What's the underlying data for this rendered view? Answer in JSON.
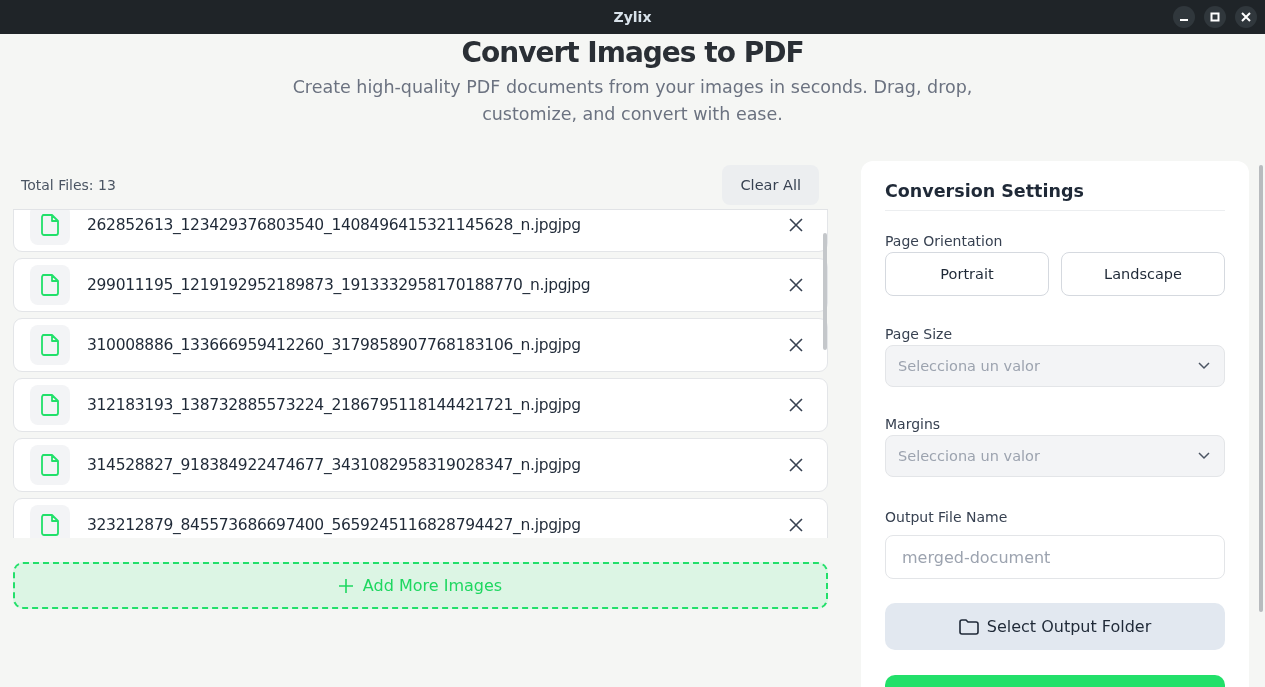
{
  "window": {
    "title": "Zylix"
  },
  "header": {
    "title": "Convert Images to PDF",
    "subtitle": "Create high-quality PDF documents from your images in seconds. Drag, drop, customize, and convert with ease."
  },
  "files": {
    "total_label": "Total Files: 13",
    "clear_button": "Clear All",
    "add_button": "Add More Images",
    "items": [
      {
        "name": "262852613_123429376803540_1408496415321145628_n.jpgjpg"
      },
      {
        "name": "299011195_1219192952189873_1913332958170188770_n.jpgjpg"
      },
      {
        "name": "310008886_133666959412260_3179858907768183106_n.jpgjpg"
      },
      {
        "name": "312183193_138732885573224_2186795118144421721_n.jpgjpg"
      },
      {
        "name": "314528827_918384922474677_3431082958319028347_n.jpgjpg"
      },
      {
        "name": "323212879_845573686697400_5659245116828794427_n.jpgjpg"
      }
    ]
  },
  "settings": {
    "title": "Conversion Settings",
    "orientation": {
      "label": "Page Orientation",
      "options": [
        {
          "label": "Portrait",
          "selected": false
        },
        {
          "label": "Landscape",
          "selected": false
        }
      ]
    },
    "page_size": {
      "label": "Page Size",
      "placeholder": "Selecciona un valor"
    },
    "margins": {
      "label": "Margins",
      "placeholder": "Selecciona un valor"
    },
    "output_name": {
      "label": "Output File Name",
      "placeholder": "merged-document"
    },
    "folder_button": "Select Output Folder"
  }
}
